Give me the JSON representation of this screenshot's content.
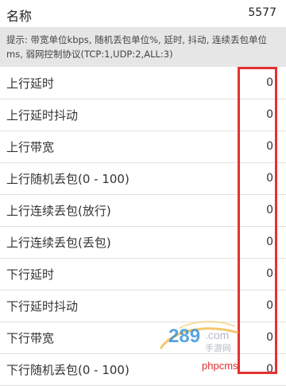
{
  "header": {
    "title": "名称",
    "count": "5577"
  },
  "hint": "提示: 带宽单位kbps, 随机丢包单位%, 延时, 抖动, 连续丢包单位ms, 弱网控制协议(TCP:1,UDP:2,ALL:3)",
  "rows": [
    {
      "label": "上行延时",
      "value": "0"
    },
    {
      "label": "上行延时抖动",
      "value": "0"
    },
    {
      "label": "上行带宽",
      "value": "0"
    },
    {
      "label": "上行随机丢包(0 - 100)",
      "value": "0"
    },
    {
      "label": "上行连续丢包(放行)",
      "value": "0"
    },
    {
      "label": "上行连续丢包(丢包)",
      "value": "0"
    },
    {
      "label": "下行延时",
      "value": "0"
    },
    {
      "label": "下行延时抖动",
      "value": "0"
    },
    {
      "label": "下行带宽",
      "value": "0"
    },
    {
      "label": "下行随机丢包(0 - 100)",
      "value": "0"
    }
  ],
  "watermark": {
    "logo_text": "289.com",
    "logo_sub": "手游网",
    "site": "phpcms"
  },
  "colors": {
    "highlight": "#e53030",
    "hint_bg": "#e6e6e6"
  }
}
